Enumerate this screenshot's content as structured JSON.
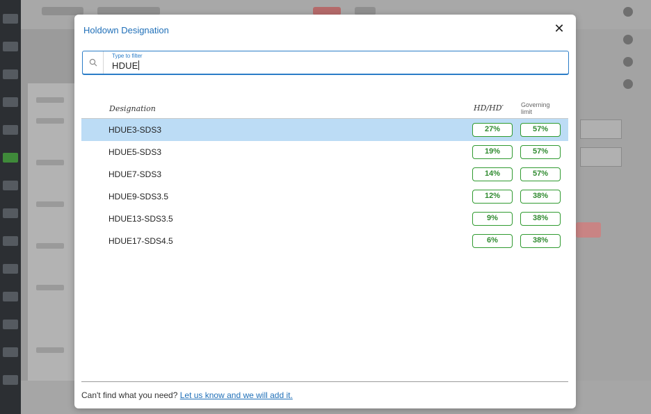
{
  "modal": {
    "title": "Holdown Designation",
    "close_icon": "close-icon"
  },
  "filter": {
    "label": "Type to filter",
    "value": "HDUE",
    "icon": "search-icon"
  },
  "table": {
    "headers": {
      "designation": "Designation",
      "hd_ratio": "HD/HD′",
      "governing_limit": "Governing limit"
    },
    "rows": [
      {
        "designation": "HDUE3-SDS3",
        "hd_ratio": "27%",
        "governing_limit": "57%",
        "selected": true
      },
      {
        "designation": "HDUE5-SDS3",
        "hd_ratio": "19%",
        "governing_limit": "57%",
        "selected": false
      },
      {
        "designation": "HDUE7-SDS3",
        "hd_ratio": "14%",
        "governing_limit": "57%",
        "selected": false
      },
      {
        "designation": "HDUE9-SDS3.5",
        "hd_ratio": "12%",
        "governing_limit": "38%",
        "selected": false
      },
      {
        "designation": "HDUE13-SDS3.5",
        "hd_ratio": "9%",
        "governing_limit": "38%",
        "selected": false
      },
      {
        "designation": "HDUE17-SDS4.5",
        "hd_ratio": "6%",
        "governing_limit": "38%",
        "selected": false
      }
    ]
  },
  "footer": {
    "text": "Can't find what you need?",
    "link": "Let us know and we will add it."
  },
  "colors": {
    "accent": "#1f6fb8",
    "selected_row": "#bcdcf5",
    "badge_green": "#2f9a2f"
  }
}
